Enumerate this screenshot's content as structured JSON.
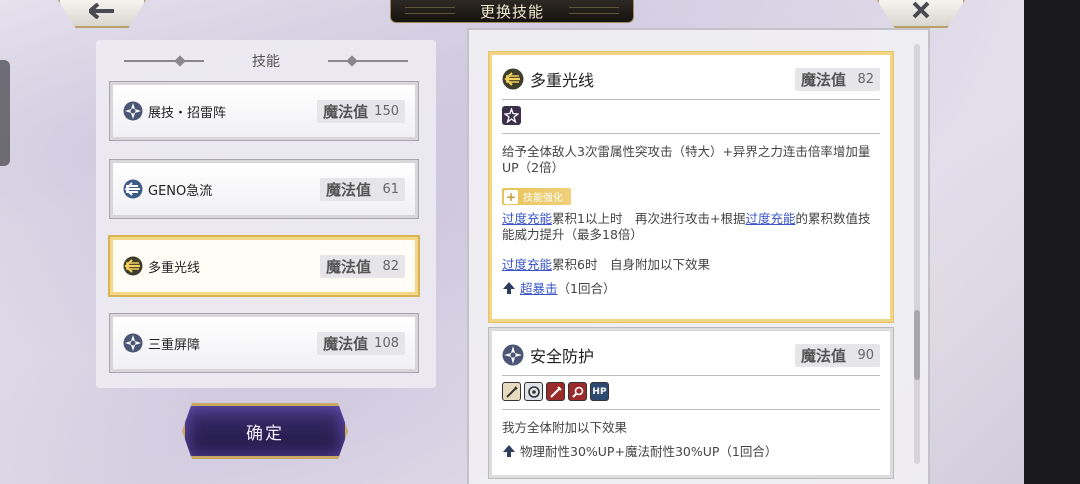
{
  "header": {
    "title": "更换技能"
  },
  "left": {
    "heading": "技能",
    "confirm_label": "确定",
    "skills": [
      {
        "name": "展技・招雷阵",
        "mp_label": "魔法值",
        "mp": "150",
        "icon": "thunder-gear-icon",
        "selected": false
      },
      {
        "name": "GENO急流",
        "mp_label": "魔法值",
        "mp": "61",
        "icon": "rapid-stream-icon",
        "selected": false
      },
      {
        "name": "多重光线",
        "mp_label": "魔法值",
        "mp": "82",
        "icon": "multi-beam-icon",
        "selected": true
      },
      {
        "name": "三重屏障",
        "mp_label": "魔法值",
        "mp": "108",
        "icon": "triple-barrier-icon",
        "selected": false
      }
    ]
  },
  "detail": {
    "card1": {
      "name": "多重光线",
      "mp_label": "魔法值",
      "mp": "82",
      "desc": "给予全体敌人3次雷属性突攻击（特大）+异界之力连击倍率增加量UP（2倍）",
      "enhance_label": "技能强化",
      "overcharge": "过度充能",
      "line1_mid": "累积1以上时　再次进行攻击+根据",
      "line1_end": "的累积数值技能威力提升（最多18倍）",
      "line2_end": "累积6时　自身附加以下效果",
      "buff_link": "超暴击",
      "buff_rest": "（1回合）"
    },
    "card2": {
      "name": "安全防护",
      "mp_label": "魔法值",
      "mp": "90",
      "tag_icons": [
        "sword-icon",
        "shield-gear-icon",
        "blade-icon",
        "search-icon",
        "hp-icon"
      ],
      "hp_text": "HP",
      "desc": "我方全体附加以下效果",
      "buff": "物理耐性30%UP+魔法耐性30%UP（1回合）"
    }
  },
  "colors": {
    "selected_border": "#f0d584",
    "link": "#3a56c8",
    "enhance": "#e7c45a"
  }
}
